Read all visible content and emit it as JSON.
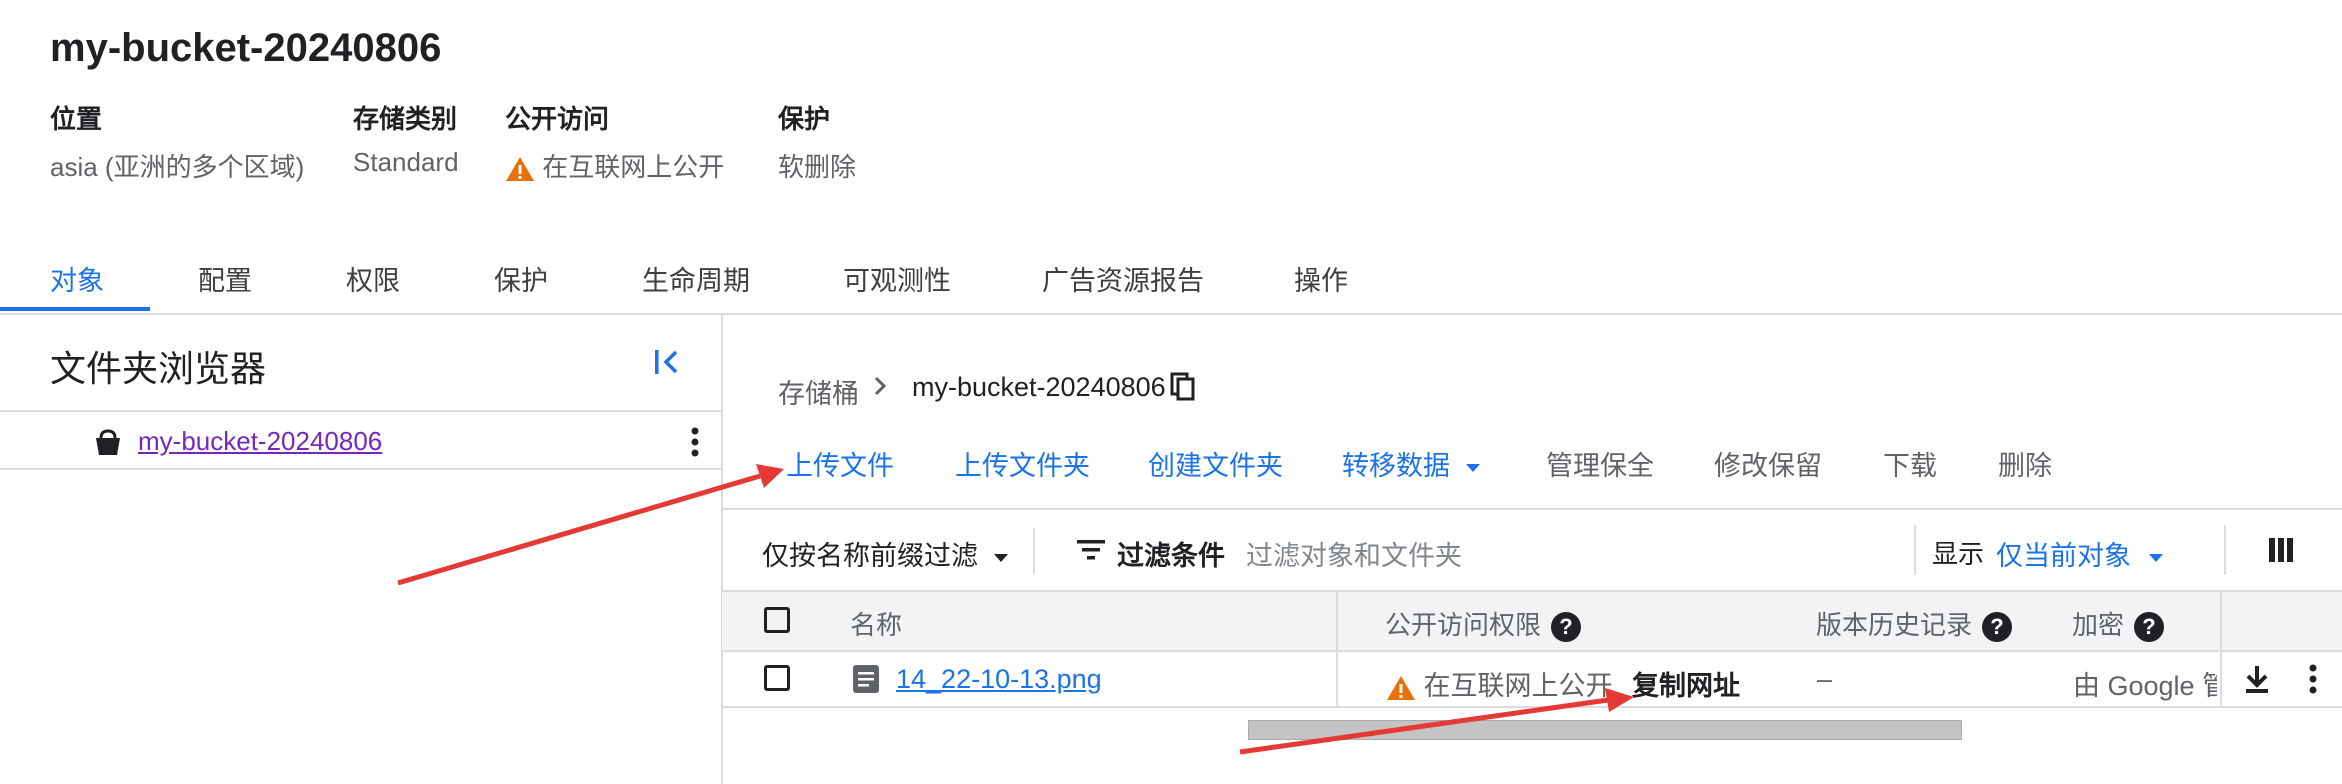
{
  "bucket": {
    "name": "my-bucket-20240806",
    "meta": [
      {
        "label": "位置",
        "value": "asia (亚洲的多个区域)"
      },
      {
        "label": "存储类别",
        "value": "Standard"
      },
      {
        "label": "公开访问",
        "value": "在互联网上公开"
      },
      {
        "label": "保护",
        "value": "软删除"
      }
    ]
  },
  "tabs": [
    "对象",
    "配置",
    "权限",
    "保护",
    "生命周期",
    "可观测性",
    "广告资源报告",
    "操作"
  ],
  "folder_browser": {
    "title": "文件夹浏览器",
    "item": "my-bucket-20240806"
  },
  "breadcrumb": {
    "root": "存储桶",
    "current": "my-bucket-20240806"
  },
  "actions": {
    "upload_file": "上传文件",
    "upload_folder": "上传文件夹",
    "create_folder": "创建文件夹",
    "transfer_data": "转移数据",
    "manage_holds": "管理保全",
    "edit_retention": "修改保留",
    "download": "下载",
    "delete": "删除"
  },
  "filter": {
    "prefix_filter": "仅按名称前缀过滤",
    "filter_label": "过滤条件",
    "placeholder": "过滤对象和文件夹",
    "show_label": "显示",
    "show_value": "仅当前对象"
  },
  "table": {
    "headers": {
      "name": "名称",
      "public_access": "公开访问权限",
      "version_history": "版本历史记录",
      "encryption": "加密"
    },
    "rows": [
      {
        "name": "14_22-10-13.png",
        "public_access": "在互联网上公开",
        "copy_url": "复制网址",
        "version_history": "–",
        "encryption": "由 Google 管理"
      }
    ]
  },
  "colors": {
    "accent": "#1a73e8",
    "warning": "#e8710a",
    "link_visited": "#7627bb",
    "annotation_arrow": "#e53935"
  },
  "icons": [
    "warning-icon",
    "collapse-panel-icon",
    "bucket-icon",
    "more-vert-icon",
    "chevron-right-icon",
    "copy-icon",
    "dropdown-arrow-icon",
    "filter-lines-icon",
    "column-display-icon",
    "help-icon",
    "file-icon",
    "download-icon"
  ]
}
